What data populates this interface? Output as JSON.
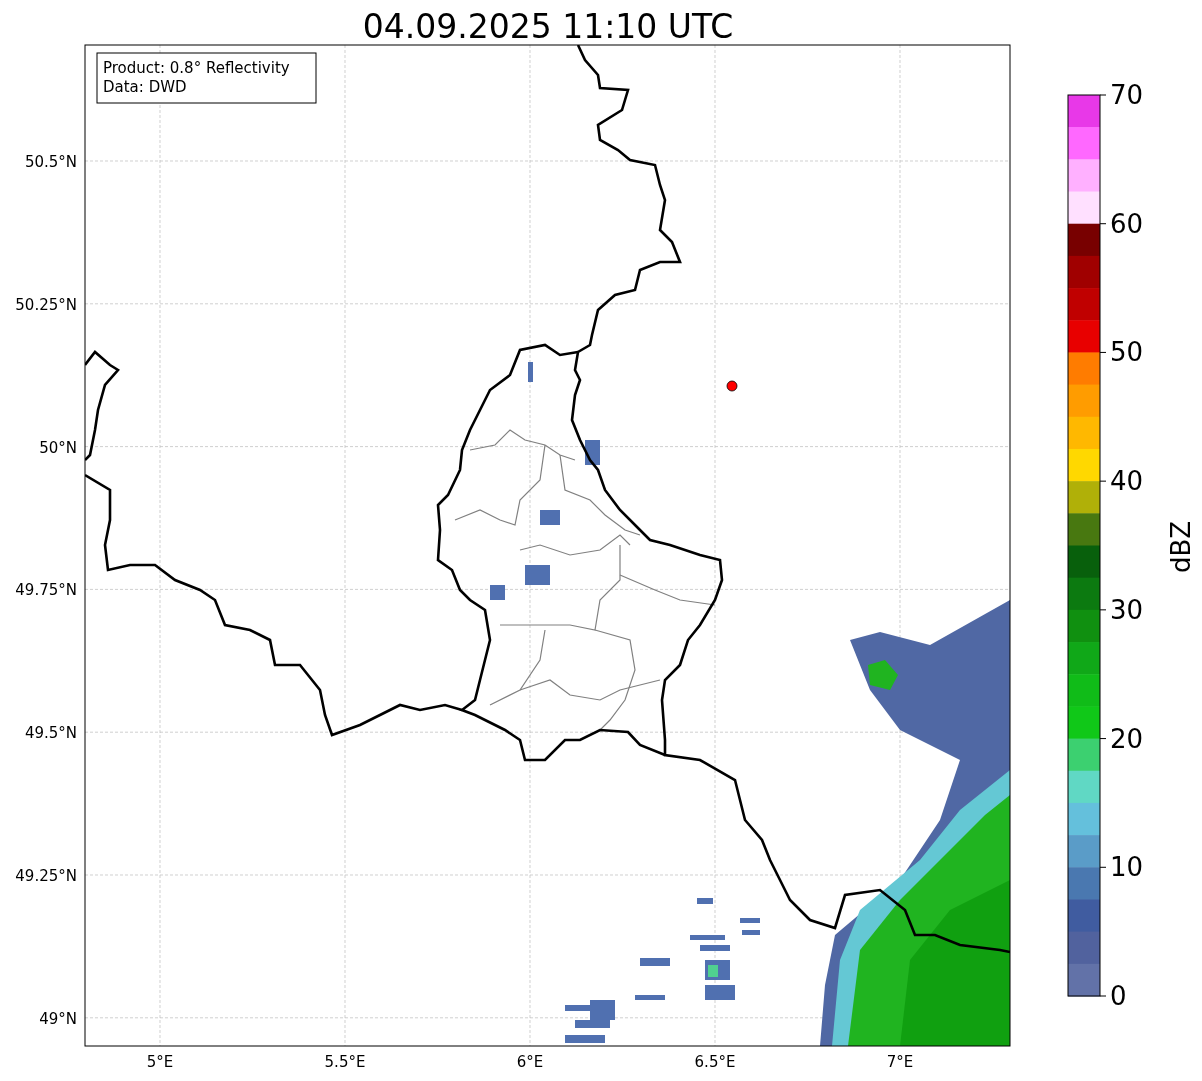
{
  "title": "04.09.2025 11:10 UTC",
  "info_box": {
    "lines": [
      "Product: 0.8° Reflectivity",
      "Data: DWD"
    ]
  },
  "map": {
    "lat_ticks": [
      "50.5°N",
      "50.25°N",
      "50°N",
      "49.75°N",
      "49.5°N",
      "49.25°N",
      "49°N"
    ],
    "lon_ticks": [
      "5°E",
      "5.5°E",
      "6°E",
      "6.5°E",
      "7°E"
    ]
  },
  "colorbar": {
    "label": "dBZ",
    "ticks": [
      "70",
      "60",
      "50",
      "40",
      "30",
      "20",
      "10",
      "0"
    ],
    "bins": [
      {
        "color": "#e838e8"
      },
      {
        "color": "#ff68ff"
      },
      {
        "color": "#ffb0ff"
      },
      {
        "color": "#ffe0ff"
      },
      {
        "color": "#780000"
      },
      {
        "color": "#a00000"
      },
      {
        "color": "#c00000"
      },
      {
        "color": "#e80000"
      },
      {
        "color": "#ff7c00"
      },
      {
        "color": "#ff9c00"
      },
      {
        "color": "#ffb800"
      },
      {
        "color": "#ffd800"
      },
      {
        "color": "#b0b008"
      },
      {
        "color": "#487810"
      },
      {
        "color": "#08600c"
      },
      {
        "color": "#0c7a10"
      },
      {
        "color": "#109010"
      },
      {
        "color": "#10a818"
      },
      {
        "color": "#10bc18"
      },
      {
        "color": "#10c818"
      },
      {
        "color": "#3cd070"
      },
      {
        "color": "#60d8c4"
      },
      {
        "color": "#64c0dc"
      },
      {
        "color": "#5a9cc8"
      },
      {
        "color": "#4a78b0"
      },
      {
        "color": "#405ca0"
      },
      {
        "color": "#51629e"
      },
      {
        "color": "#6272a8"
      }
    ]
  }
}
